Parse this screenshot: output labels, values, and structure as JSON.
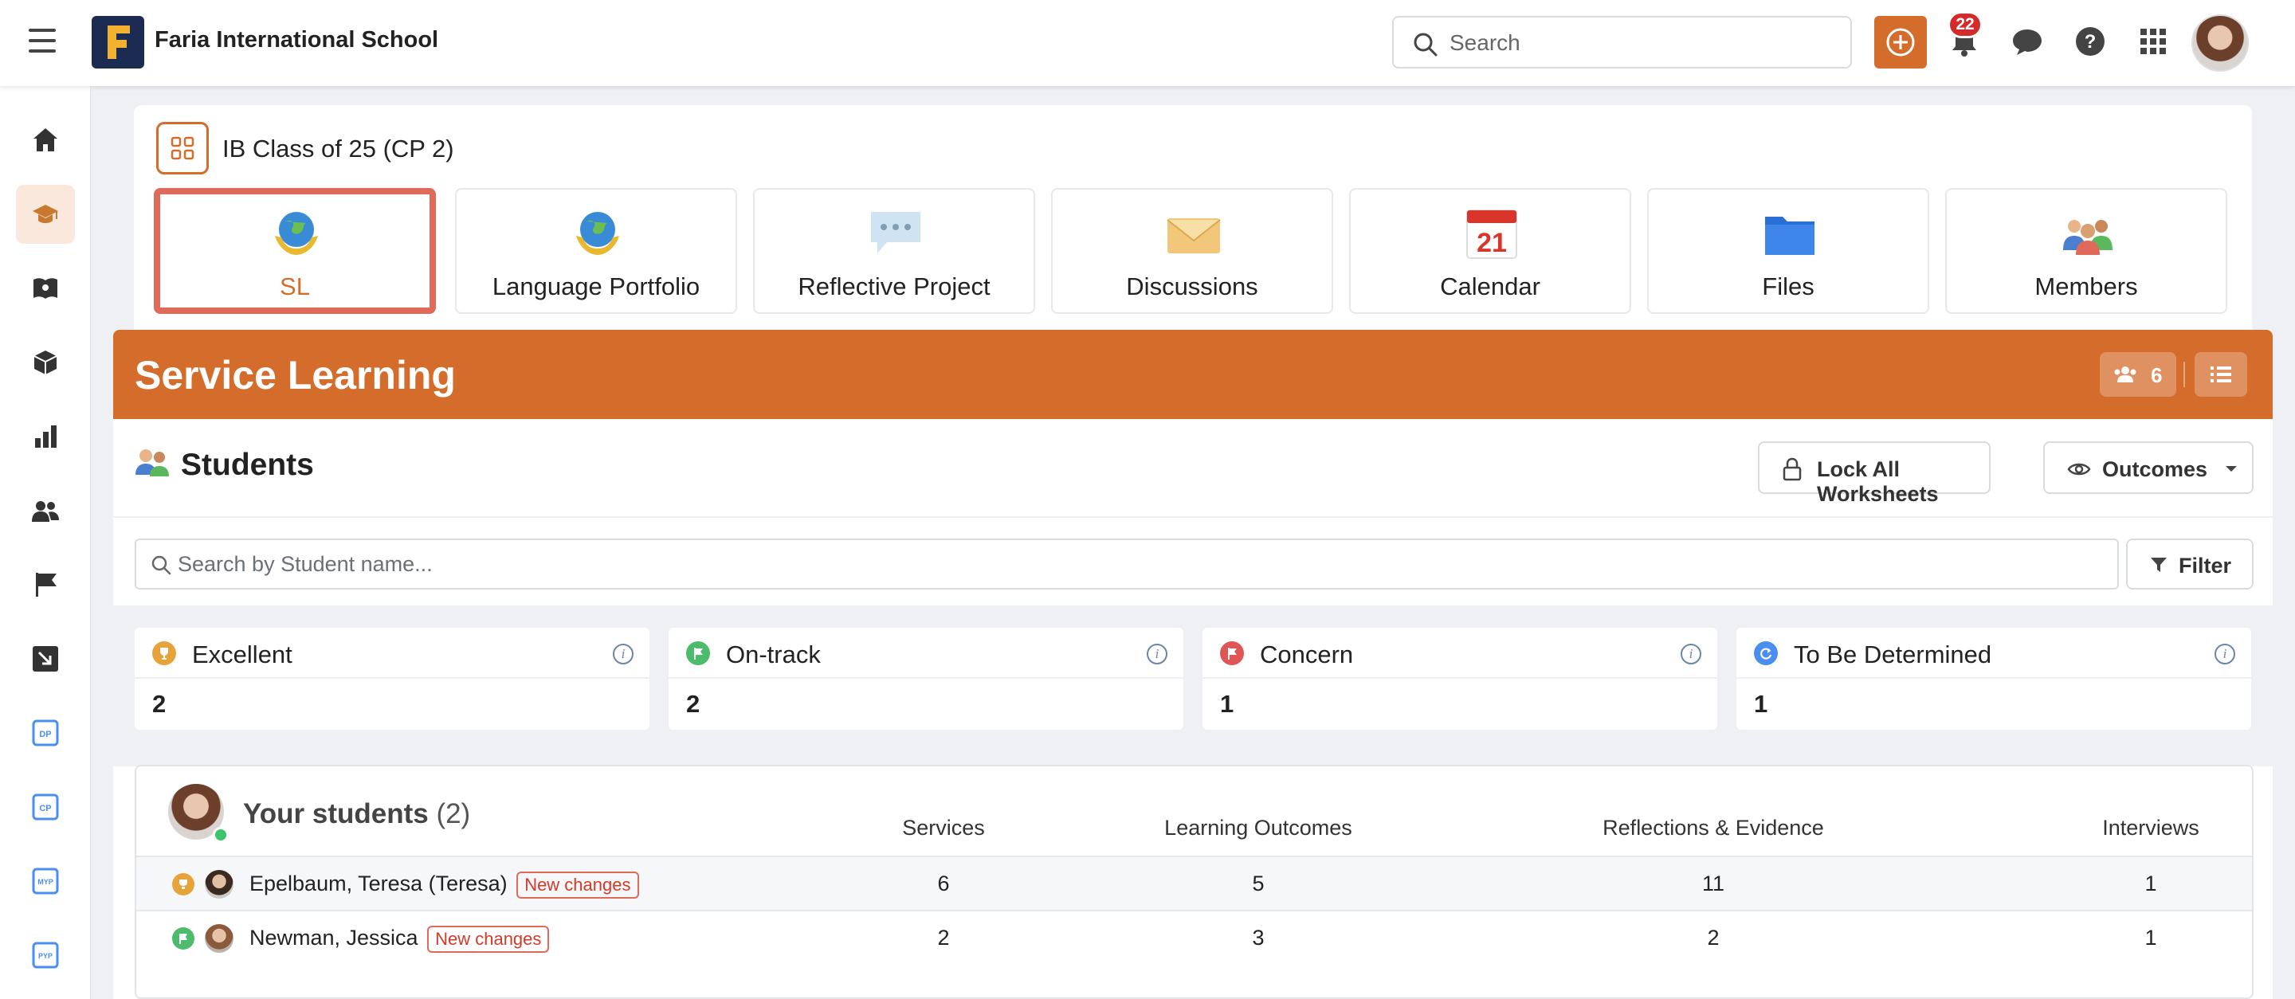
{
  "topbar": {
    "school_name": "Faria International School",
    "search_placeholder": "Search",
    "notification_count": "22",
    "colors": {
      "accent": "#d46d2c",
      "badge": "#d42a2a",
      "logo_bg": "#1c2b52"
    }
  },
  "sidebar": {
    "items": [
      {
        "icon": "home-icon"
      },
      {
        "icon": "graduation-cap-icon",
        "active": true
      },
      {
        "icon": "book-icon"
      },
      {
        "icon": "cube-icon"
      },
      {
        "icon": "bar-chart-icon"
      },
      {
        "icon": "users-icon"
      },
      {
        "icon": "flag-icon"
      },
      {
        "icon": "arrow-down-right-icon"
      },
      {
        "icon": "dp-icon"
      },
      {
        "icon": "cp-icon"
      },
      {
        "icon": "myp-icon"
      },
      {
        "icon": "pyp-icon"
      }
    ]
  },
  "class": {
    "title": "IB Class of 25 (CP 2)",
    "tiles": [
      {
        "label": "SL",
        "icon": "globe-hands-icon",
        "selected": true
      },
      {
        "label": "Language Portfolio",
        "icon": "globe-hands-icon"
      },
      {
        "label": "Reflective Project",
        "icon": "speech-bubble-icon"
      },
      {
        "label": "Discussions",
        "icon": "envelope-icon"
      },
      {
        "label": "Calendar",
        "icon": "calendar-icon",
        "calendar_day": "21"
      },
      {
        "label": "Files",
        "icon": "folder-icon"
      },
      {
        "label": "Members",
        "icon": "people-icon"
      }
    ]
  },
  "service_learning": {
    "title": "Service Learning",
    "member_count": "6",
    "students_title": "Students",
    "lock_label": "Lock All Worksheets",
    "outcomes_label": "Outcomes",
    "search_placeholder": "Search by Student name...",
    "filter_label": "Filter",
    "stats": [
      {
        "label": "Excellent",
        "value": "2",
        "color": "#e8a23a",
        "icon": "trophy-icon"
      },
      {
        "label": "On-track",
        "value": "2",
        "color": "#4cbb6c",
        "icon": "flag-icon"
      },
      {
        "label": "Concern",
        "value": "1",
        "color": "#e05555",
        "icon": "flag-icon"
      },
      {
        "label": "To Be Determined",
        "value": "1",
        "color": "#4a8ef0",
        "icon": "refresh-icon"
      }
    ],
    "table": {
      "heading": "Your students",
      "count": "(2)",
      "columns": [
        "Services",
        "Learning Outcomes",
        "Reflections & Evidence",
        "Interviews"
      ],
      "rows": [
        {
          "name": "Epelbaum, Teresa (Teresa)",
          "badge": "New changes",
          "status": "excellent",
          "values": [
            "6",
            "5",
            "11",
            "1"
          ]
        },
        {
          "name": "Newman, Jessica",
          "badge": "New changes",
          "status": "on-track",
          "values": [
            "2",
            "3",
            "2",
            "1"
          ]
        }
      ]
    }
  }
}
